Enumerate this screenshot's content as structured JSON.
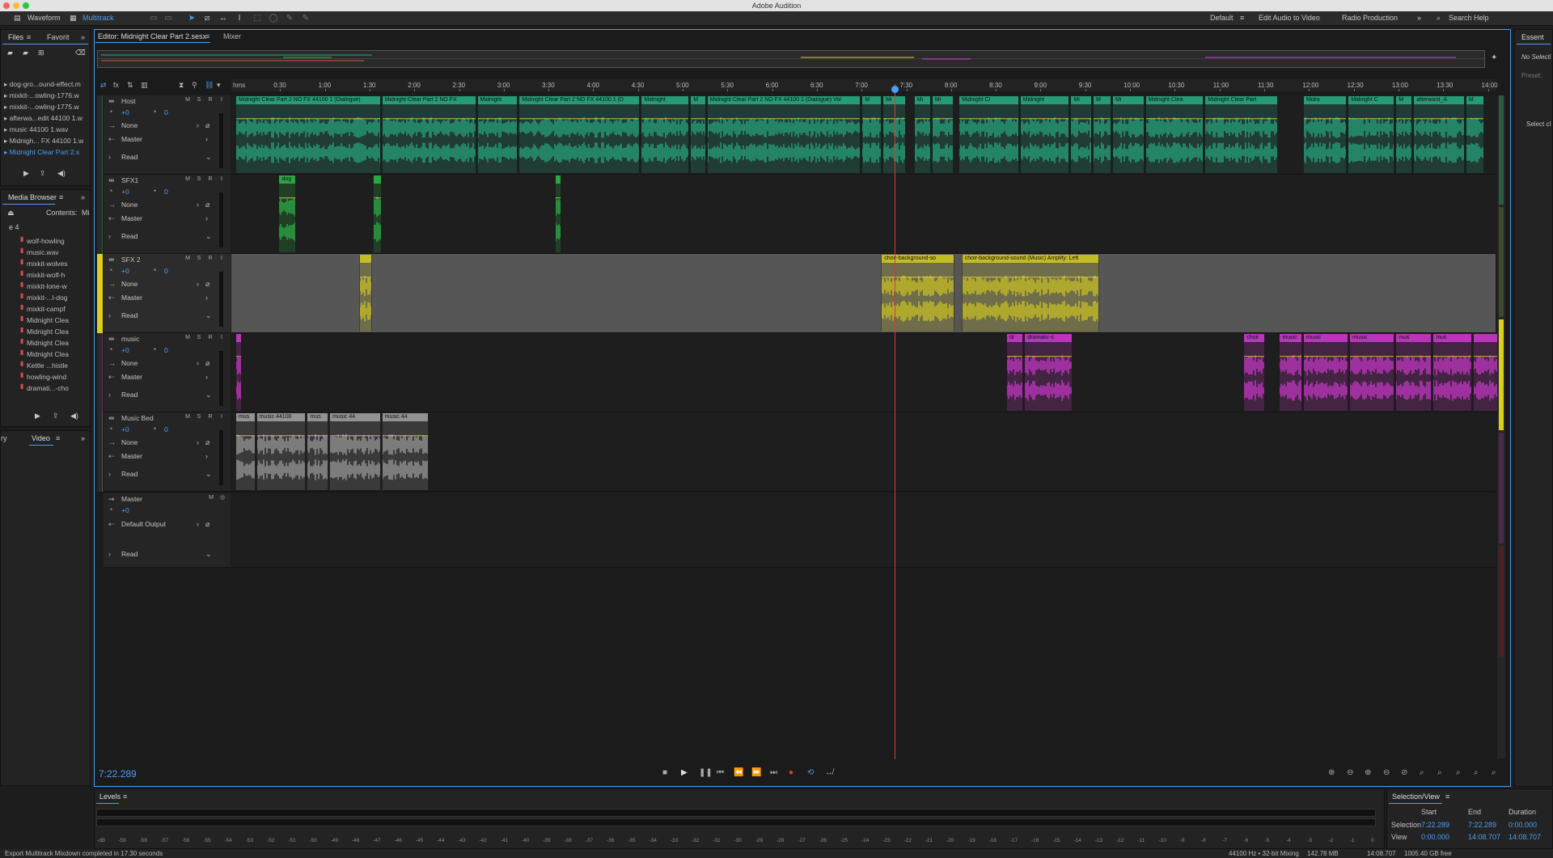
{
  "app": {
    "title": "Adobe Audition"
  },
  "toolbar": {
    "waveform_label": "Waveform",
    "multitrack_label": "Multitrack",
    "workspaces": [
      "Default",
      "Edit Audio to Video",
      "Radio Production"
    ],
    "search_placeholder": "Search Help"
  },
  "files_panel": {
    "tabs": [
      "Files",
      "Favorit"
    ],
    "items": [
      "dog-gro...ound-effect.m",
      "mixkit-...owling-1776.w",
      "mixkit-...owling-1775.w",
      "afterwa...edit 44100 1.w",
      "music 44100 1.wav",
      "Midnigh... FX 44100 1.w",
      "Midnight Clear Part 2.s"
    ]
  },
  "media_browser": {
    "title": "Media Browser",
    "contents_label": "Contents:",
    "contents_value": "Mi",
    "drive_label": "e 4",
    "items": [
      "wolf-howling",
      "music.wav",
      "mixkit-wolves",
      "mixkit-wolf-h",
      "mixkit-lone-w",
      "mixkit-...l-dog",
      "mixkit-campf",
      "Midnight Clea",
      "Midnight Clea",
      "Midnight Clea",
      "Midnight Clea",
      "Kettle ...histle",
      "howling-wind",
      "dramati...-cho"
    ]
  },
  "bottom_left_tabs": [
    "ry",
    "Video"
  ],
  "editor": {
    "tab_label": "Editor: Midnight Clear Part 2.sesx",
    "mixer_label": "Mixer",
    "ruler_unit": "hms",
    "ruler_labels": [
      "0:30",
      "1:00",
      "1:30",
      "2:00",
      "2:30",
      "3:00",
      "3:30",
      "4:00",
      "4:30",
      "5:00",
      "5:30",
      "6:00",
      "6:30",
      "7:00",
      "7:30",
      "8:00",
      "8:30",
      "9:00",
      "9:30",
      "10:00",
      "10:30",
      "11:00",
      "11:30",
      "12:00",
      "12:30",
      "13:00",
      "13:30",
      "14:00"
    ],
    "timecode": "7:22.289",
    "playhead_time_seconds": 442.289,
    "total_seconds": 848.707
  },
  "tracks": [
    {
      "name": "Host",
      "volume": "+0",
      "pan": "0",
      "input": "None",
      "output": "Master",
      "mode": "Read",
      "color": "#27b38a",
      "clips": [
        {
          "title": "Midnight Clear Part 2 NO FX 44100 1 (Dialogue)",
          "start": 0,
          "end": 98
        },
        {
          "title": "Midnight Clear Part 2 NO FX",
          "start": 98,
          "end": 162
        },
        {
          "title": "Midnight",
          "start": 162,
          "end": 190
        },
        {
          "title": "Midnight Clear Part 2 NO FX 44100 1 (D",
          "start": 190,
          "end": 272
        },
        {
          "title": "Midnight",
          "start": 272,
          "end": 305
        },
        {
          "title": "M",
          "start": 305,
          "end": 316
        },
        {
          "title": "Midnight Clear Part 2 NO FX 44100 1 (Dialogue) Vol",
          "start": 316,
          "end": 420
        },
        {
          "title": "M",
          "start": 420,
          "end": 434
        },
        {
          "title": "Mi",
          "start": 434,
          "end": 450
        },
        {
          "title": "Mi",
          "start": 455,
          "end": 467
        },
        {
          "title": "Mi",
          "start": 467,
          "end": 482
        },
        {
          "title": "Midnight Cl",
          "start": 485,
          "end": 526
        },
        {
          "title": "Midnight",
          "start": 526,
          "end": 560
        },
        {
          "title": "Mi",
          "start": 560,
          "end": 575
        },
        {
          "title": "M",
          "start": 575,
          "end": 588
        },
        {
          "title": "Mi",
          "start": 588,
          "end": 610
        },
        {
          "title": "Midnight Clea",
          "start": 610,
          "end": 650
        },
        {
          "title": "Midnight Clear Part",
          "start": 650,
          "end": 700
        },
        {
          "title": "Midni",
          "start": 716,
          "end": 746
        },
        {
          "title": "Midnight C",
          "start": 746,
          "end": 778
        },
        {
          "title": "M",
          "start": 778,
          "end": 790
        },
        {
          "title": "afterward_A",
          "start": 790,
          "end": 825
        },
        {
          "title": "M",
          "start": 825,
          "end": 838
        }
      ]
    },
    {
      "name": "SFX1",
      "volume": "+0",
      "pan": "0",
      "input": "None",
      "output": "Master",
      "mode": "Read",
      "color": "#2fbf4a",
      "clips": [
        {
          "title": "dog",
          "start": 29,
          "end": 41
        },
        {
          "title": "",
          "start": 92,
          "end": 99
        },
        {
          "title": "",
          "start": 214,
          "end": 219
        }
      ]
    },
    {
      "name": "SFX 2",
      "volume": "+0",
      "pan": "0",
      "input": "None",
      "output": "Master",
      "mode": "Read",
      "color": "#d9cf1c",
      "clips": [
        {
          "title": "",
          "start": 83,
          "end": 92
        },
        {
          "title": "choir-background-so",
          "start": 433,
          "end": 483
        },
        {
          "title": "choir-background-sound (Music)   Amplify: Left",
          "start": 487,
          "end": 580
        }
      ]
    },
    {
      "name": "music",
      "volume": "+0",
      "pan": "0",
      "input": "None",
      "output": "Master",
      "mode": "Read",
      "color": "#d93ad9",
      "clips": [
        {
          "title": "",
          "start": 0,
          "end": 5
        },
        {
          "title": "dr",
          "start": 517,
          "end": 529
        },
        {
          "title": "dramatic-s",
          "start": 529,
          "end": 562
        },
        {
          "title": "choir",
          "start": 676,
          "end": 691
        },
        {
          "title": "music",
          "start": 700,
          "end": 716
        },
        {
          "title": "music",
          "start": 716,
          "end": 747
        },
        {
          "title": "music",
          "start": 747,
          "end": 778
        },
        {
          "title": "mus",
          "start": 778,
          "end": 803
        },
        {
          "title": "mus",
          "start": 803,
          "end": 830
        },
        {
          "title": "",
          "start": 830,
          "end": 848
        }
      ]
    },
    {
      "name": "Music Bed",
      "volume": "+0",
      "pan": "0",
      "input": "None",
      "output": "Master",
      "mode": "Read",
      "color": "#a9a9a9",
      "clips": [
        {
          "title": "mus",
          "start": 0,
          "end": 14
        },
        {
          "title": "music 44100",
          "start": 14,
          "end": 48
        },
        {
          "title": "mus",
          "start": 48,
          "end": 63
        },
        {
          "title": "music 44",
          "start": 63,
          "end": 98
        },
        {
          "title": "music 44",
          "start": 98,
          "end": 130
        }
      ]
    }
  ],
  "master_track": {
    "name": "Master",
    "volume": "+0",
    "output": "Default Output",
    "mode": "Read"
  },
  "levels": {
    "title": "Levels",
    "scale": [
      "-dB",
      "-59",
      "-58",
      "-57",
      "-56",
      "-55",
      "-54",
      "-53",
      "-52",
      "-51",
      "-50",
      "-49",
      "-48",
      "-47",
      "-46",
      "-45",
      "-44",
      "-43",
      "-42",
      "-41",
      "-40",
      "-39",
      "-38",
      "-37",
      "-36",
      "-35",
      "-34",
      "-33",
      "-32",
      "-31",
      "-30",
      "-29",
      "-28",
      "-27",
      "-26",
      "-25",
      "-24",
      "-23",
      "-22",
      "-21",
      "-20",
      "-19",
      "-18",
      "-17",
      "-16",
      "-15",
      "-14",
      "-13",
      "-12",
      "-11",
      "-10",
      "-9",
      "-8",
      "-7",
      "-6",
      "-5",
      "-4",
      "-3",
      "-2",
      "-1",
      "0"
    ]
  },
  "selection_view": {
    "title": "Selection/View",
    "headers": [
      "Start",
      "End",
      "Duration"
    ],
    "selection": {
      "label": "Selection",
      "start": "7:22.289",
      "end": "7:22.289",
      "duration": "0:00.000"
    },
    "view": {
      "label": "View",
      "start": "0:00.000",
      "end": "14:08.707",
      "duration": "14:08.707"
    }
  },
  "essential": {
    "title": "Essent",
    "no_selection": "No Selecti",
    "preset": "Preset:",
    "select": "Select cl"
  },
  "status": {
    "message": "Export Multitrack Mixdown completed in 17.30 seconds",
    "sample_rate": "44100 Hz • 32-bit Mixing",
    "memory": "142.78 MB",
    "duration": "14:08.707",
    "free": "1005.40 GB free"
  },
  "track_controls": {
    "m": "M",
    "s": "S",
    "r": "R",
    "i": "I"
  }
}
